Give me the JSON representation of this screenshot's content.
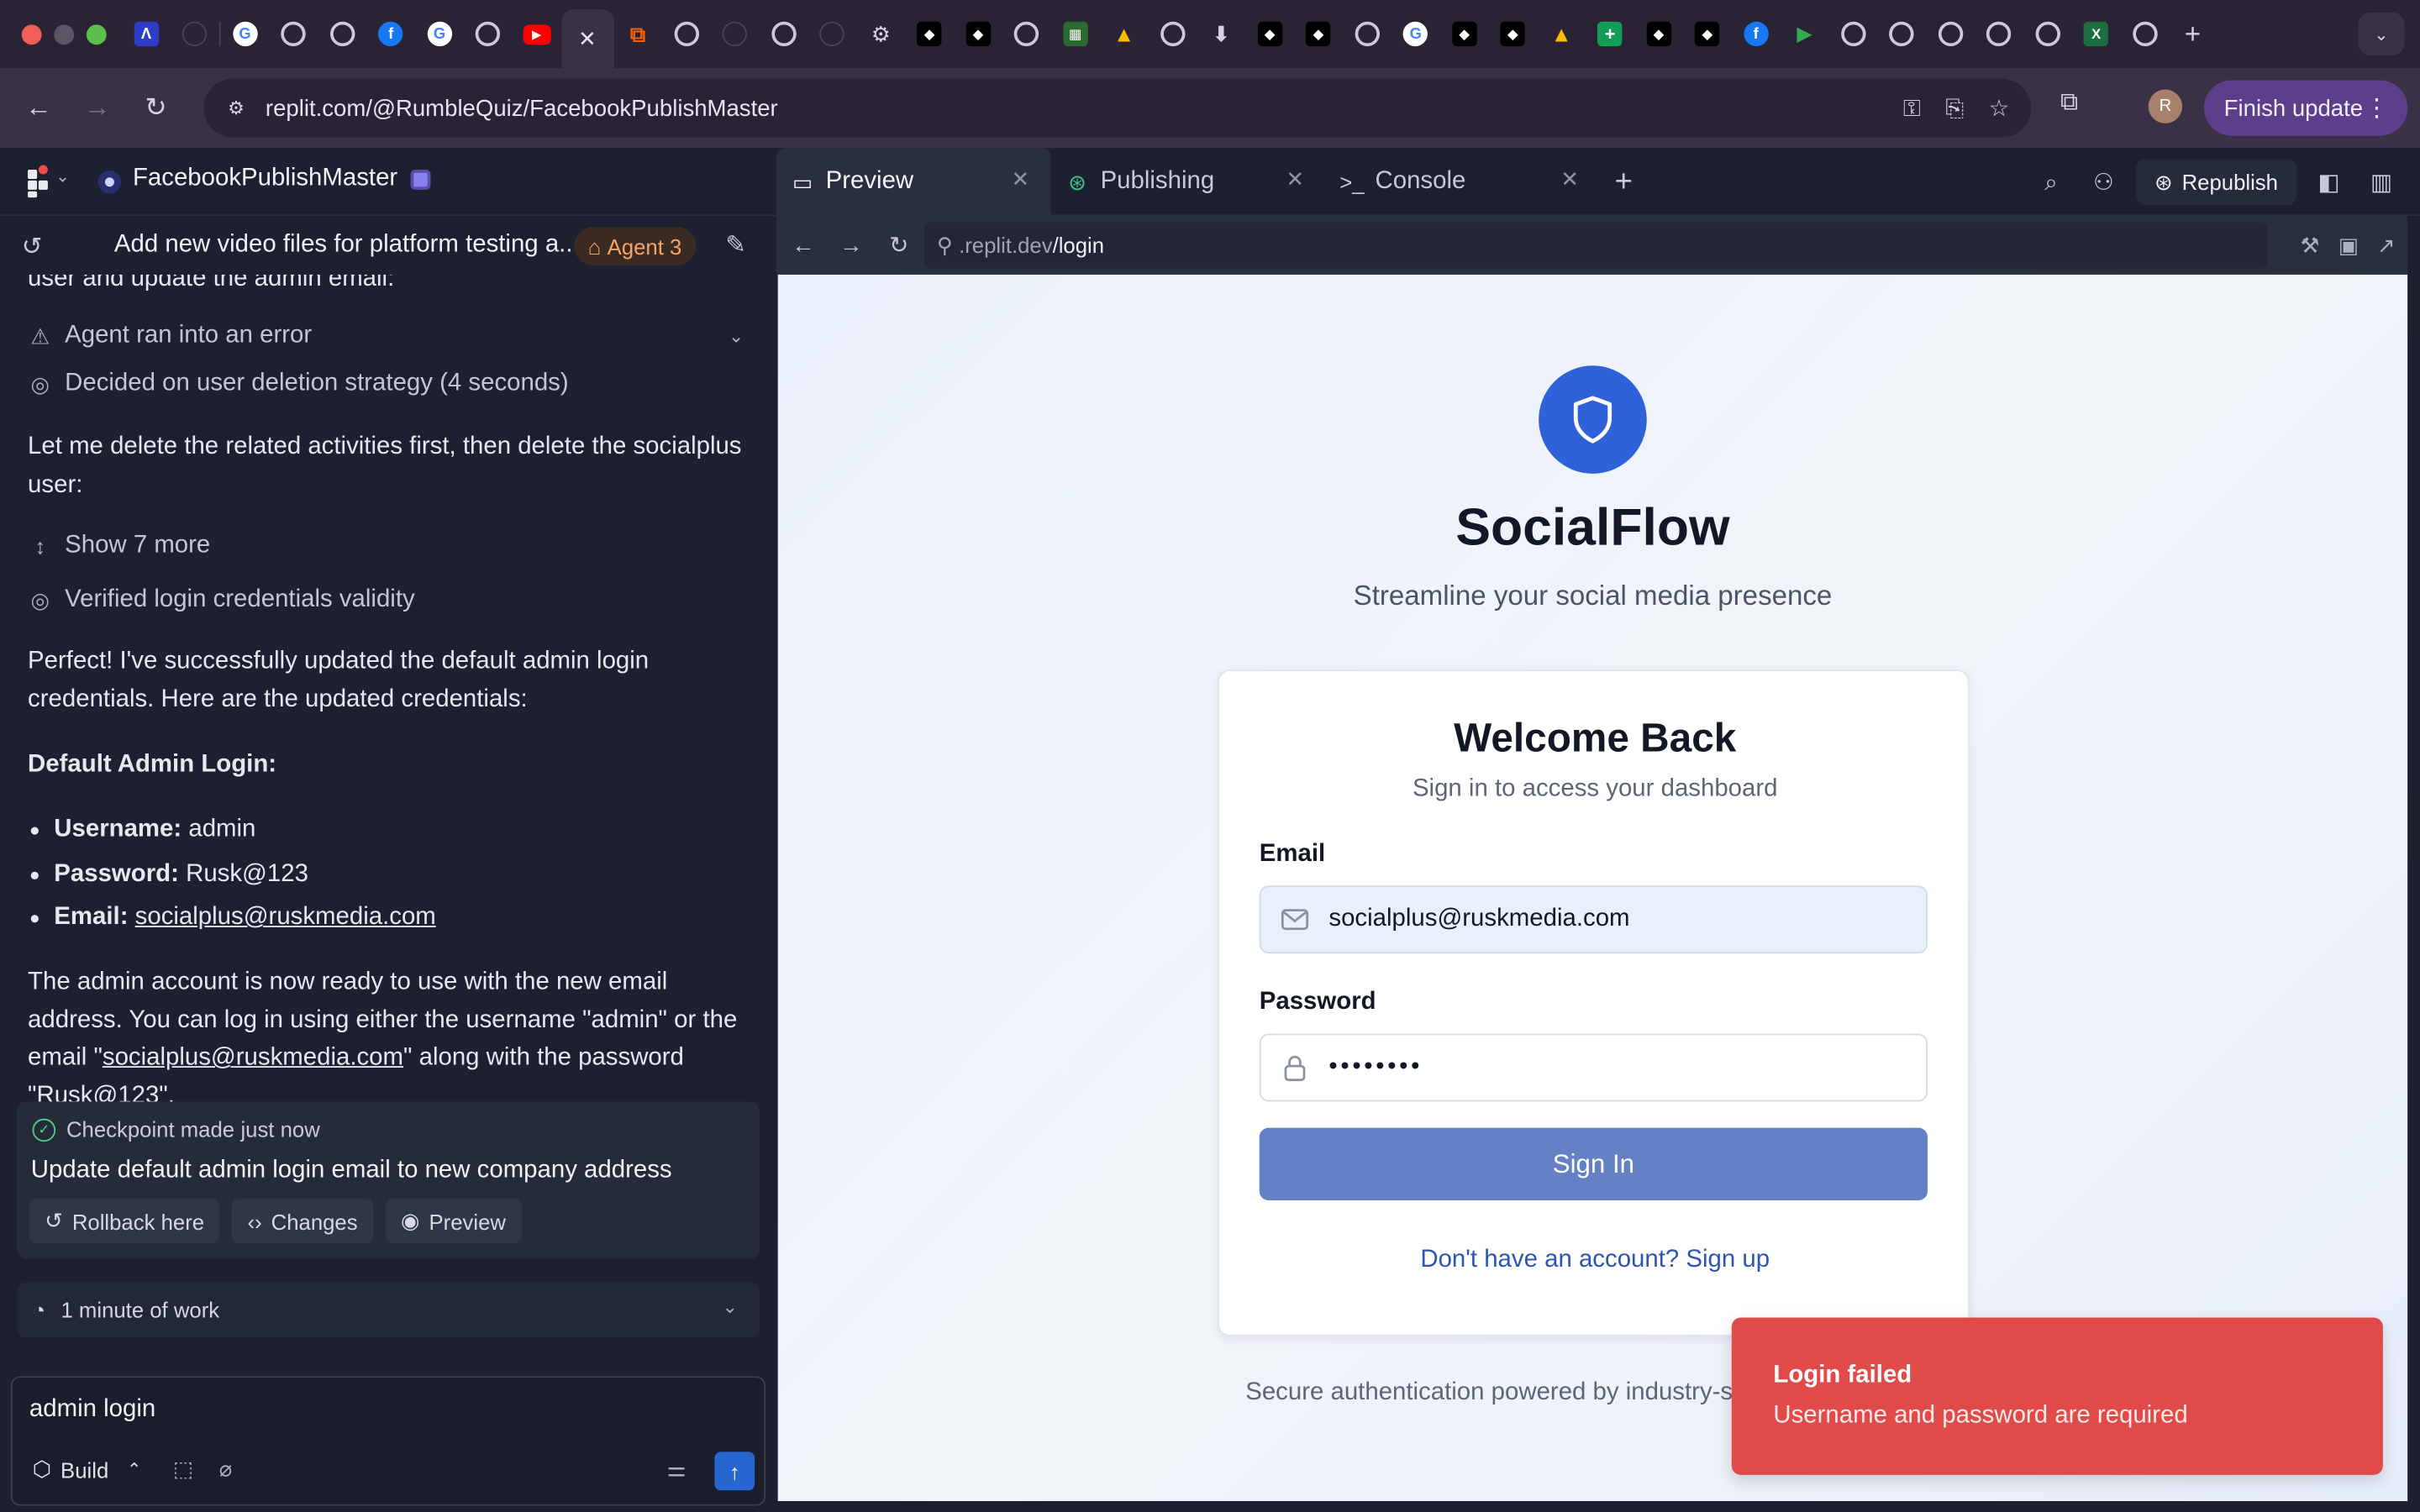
{
  "browser": {
    "url": "replit.com/@RumbleQuiz/FacebookPublishMaster",
    "finish_update_label": "Finish update",
    "profile_initial": "R",
    "tab_icons": [
      "altar-icon",
      "circle-dark-icon",
      "chrome-icon",
      "google-icon",
      "chrome-icon",
      "chrome-icon",
      "facebook-icon",
      "google-icon",
      "chrome-icon",
      "youtube-icon",
      "close-icon",
      "replit-icon",
      "chrome-icon",
      "circle-dark-icon",
      "chrome-icon",
      "circle-dark-icon",
      "gear-icon",
      "box-icon",
      "box-icon",
      "chrome-icon",
      "clapper-icon",
      "drive-icon",
      "chrome-icon",
      "download-icon",
      "box-icon",
      "box-icon",
      "chrome-icon",
      "google-icon",
      "box-icon",
      "box-icon",
      "drive-icon",
      "sheets-icon",
      "box-icon",
      "box-icon",
      "facebook-icon",
      "play-icon",
      "chrome-icon",
      "chrome-icon",
      "chrome-icon",
      "chrome-icon",
      "chrome-icon",
      "excel-icon",
      "chrome-icon"
    ]
  },
  "workspace": {
    "project_name": "FacebookPublishMaster",
    "tabs": [
      {
        "label": "Preview",
        "icon": "monitor-icon",
        "active": true
      },
      {
        "label": "Publishing",
        "icon": "antenna-icon",
        "active": false
      },
      {
        "label": "Console",
        "icon": "terminal-icon",
        "active": false
      }
    ],
    "republish_label": "Republish"
  },
  "chat": {
    "thread_title": "Add new video files for platform testing a...",
    "agent_badge": "Agent 3",
    "clipped_line": "user and update the admin email:",
    "step_error": "Agent ran into an error",
    "step_decided": "Decided on user deletion strategy (4 seconds)",
    "para1": "Let me delete the related activities first, then delete the socialplus user:",
    "show_more": "Show 7 more",
    "step_verified": "Verified login credentials validity",
    "para2": "Perfect! I've successfully updated the default admin login credentials. Here are the updated credentials:",
    "heading": "Default Admin Login:",
    "credentials": {
      "username_label": "Username:",
      "username_value": "admin",
      "password_label": "Password:",
      "password_value": "Rusk@123",
      "email_label": "Email:",
      "email_value": "socialplus@ruskmedia.com"
    },
    "para3_a": "The admin account is now ready to use with the new email address. You can log in using either the username \"admin\" or the email \"",
    "para3_link": "socialplus@ruskmedia.com",
    "para3_b": "\" along with the password \"Rusk@123\".",
    "checkpoint": {
      "label": "Checkpoint made",
      "time": "just now",
      "title": "Update default admin login email to new company address",
      "rollback": "Rollback here",
      "changes": "Changes",
      "preview": "Preview"
    },
    "work_summary": "1 minute of work",
    "composer_text": "admin login",
    "build_label": "Build"
  },
  "preview": {
    "url_domain": ".replit.dev",
    "url_path": "/login",
    "brand": "SocialFlow",
    "tagline": "Streamline your social media presence",
    "card_title": "Welcome Back",
    "card_subtitle": "Sign in to access your dashboard",
    "email_label": "Email",
    "email_value": "socialplus@ruskmedia.com",
    "password_label": "Password",
    "password_value": "••••••••",
    "signin_label": "Sign In",
    "signup_link": "Don't have an account? Sign up",
    "footer": "Secure authentication powered by industry-s"
  },
  "toast": {
    "title": "Login failed",
    "message": "Username and password are required"
  },
  "colors": {
    "accent_blue": "#2f61d8",
    "signin_button": "#6381c4",
    "toast_red": "#e04a49",
    "agent_badge": "#f4a46a",
    "finish_update": "#5b3f8a"
  }
}
